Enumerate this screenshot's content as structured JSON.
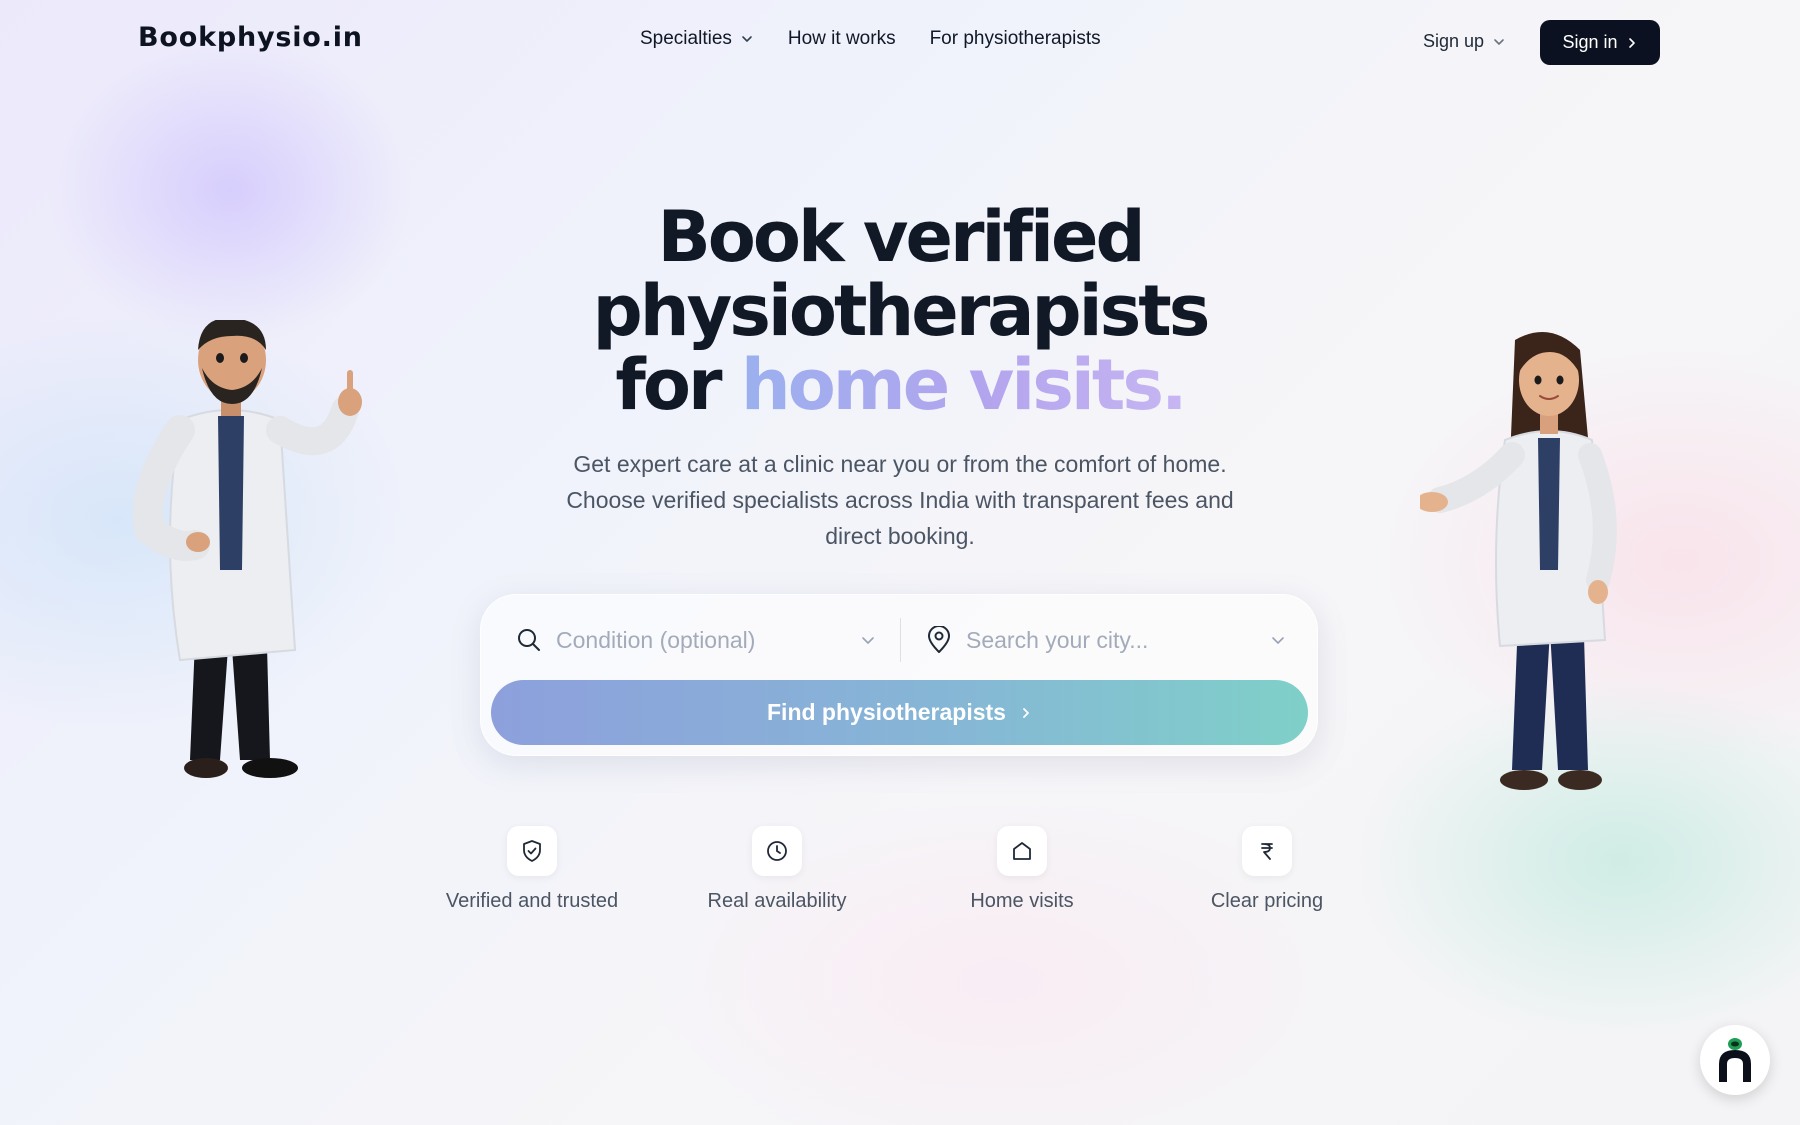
{
  "brand": {
    "logo": "Bookphysio.in"
  },
  "nav": {
    "items": [
      {
        "label": "Specialties",
        "has_dropdown": true
      },
      {
        "label": "How it works",
        "has_dropdown": false
      },
      {
        "label": "For physiotherapists",
        "has_dropdown": false
      }
    ],
    "sign_up": "Sign up",
    "sign_in": "Sign in"
  },
  "hero": {
    "title_line1": "Book verified",
    "title_line2": "physiotherapists",
    "title_line3_prefix": "for",
    "title_line3_accent": "home visits.",
    "subtitle": "Get expert care at a clinic near you or from the comfort of home. Choose verified specialists across India with transparent fees and direct booking."
  },
  "search": {
    "condition_placeholder": "Condition (optional)",
    "condition_value": "",
    "city_placeholder": "Search your city...",
    "city_value": "",
    "submit_label": "Find physiotherapists"
  },
  "features": [
    {
      "label": "Verified and trusted",
      "icon": "shield-check-icon"
    },
    {
      "label": "Real availability",
      "icon": "clock-icon"
    },
    {
      "label": "Home visits",
      "icon": "home-icon"
    },
    {
      "label": "Clear pricing",
      "icon": "rupee-icon"
    }
  ],
  "colors": {
    "primary_dark": "#0b1120",
    "button_gradient_start": "#8da0dc",
    "button_gradient_end": "#7fd0c8",
    "accent_text": "#b3a4ee"
  }
}
